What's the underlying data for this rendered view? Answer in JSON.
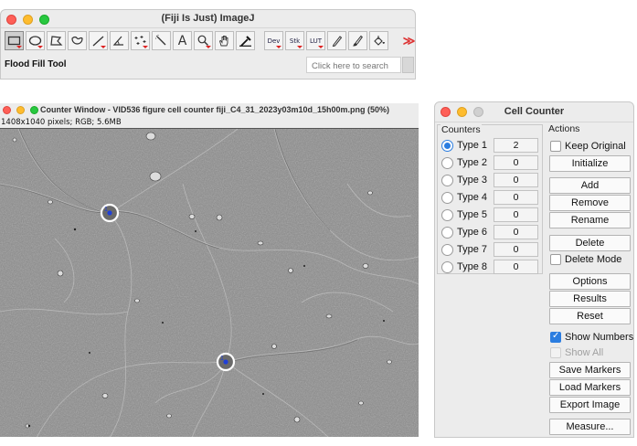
{
  "fiji": {
    "title": "(Fiji Is Just) ImageJ",
    "status": "Flood Fill Tool",
    "search_placeholder": "Click here to search",
    "tools": [
      {
        "icon": "rectangle-icon"
      },
      {
        "icon": "oval-icon"
      },
      {
        "icon": "polygon-icon"
      },
      {
        "icon": "freehand-icon"
      },
      {
        "icon": "line-icon"
      },
      {
        "icon": "angle-icon"
      },
      {
        "icon": "multipoint-icon"
      },
      {
        "icon": "wand-icon"
      },
      {
        "icon": "text-icon",
        "glyph": "A"
      },
      {
        "icon": "magnifier-icon"
      },
      {
        "icon": "hand-icon"
      },
      {
        "icon": "dropper-icon"
      },
      {
        "label": "Dev"
      },
      {
        "label": "Stk"
      },
      {
        "label": "LUT"
      },
      {
        "icon": "pencil-icon"
      },
      {
        "icon": "brush-icon"
      },
      {
        "icon": "flood-fill-icon"
      },
      {
        "icon": "more-tools-icon",
        "glyph": "≫"
      }
    ]
  },
  "counter_window": {
    "title": "Counter Window - VID536 figure cell counter fiji_C4_31_2023y03m10d_15h00m.png (50%)",
    "info": "1408x1040 pixels; RGB; 5.6MB",
    "markers": [
      {
        "label": "1",
        "type": "Type 1"
      },
      {
        "label": "1",
        "type": "Type 1"
      }
    ]
  },
  "cell_counter": {
    "title": "Cell Counter",
    "counters_label": "Counters",
    "actions_label": "Actions",
    "counters": [
      {
        "label": "Type 1",
        "count": "2",
        "selected": true
      },
      {
        "label": "Type 2",
        "count": "0",
        "selected": false
      },
      {
        "label": "Type 3",
        "count": "0",
        "selected": false
      },
      {
        "label": "Type 4",
        "count": "0",
        "selected": false
      },
      {
        "label": "Type 5",
        "count": "0",
        "selected": false
      },
      {
        "label": "Type 6",
        "count": "0",
        "selected": false
      },
      {
        "label": "Type 7",
        "count": "0",
        "selected": false
      },
      {
        "label": "Type 8",
        "count": "0",
        "selected": false
      }
    ],
    "keep_original": {
      "label": "Keep Original",
      "checked": false
    },
    "initialize": "Initialize",
    "add": "Add",
    "remove": "Remove",
    "rename": "Rename",
    "delete": "Delete",
    "delete_mode": {
      "label": "Delete Mode",
      "checked": false
    },
    "options": "Options",
    "results": "Results",
    "reset": "Reset",
    "show_numbers": {
      "label": "Show Numbers",
      "checked": true
    },
    "show_all": {
      "label": "Show All",
      "checked": false,
      "disabled": true
    },
    "save_markers": "Save Markers",
    "load_markers": "Load Markers",
    "export_image": "Export Image",
    "measure": "Measure..."
  }
}
